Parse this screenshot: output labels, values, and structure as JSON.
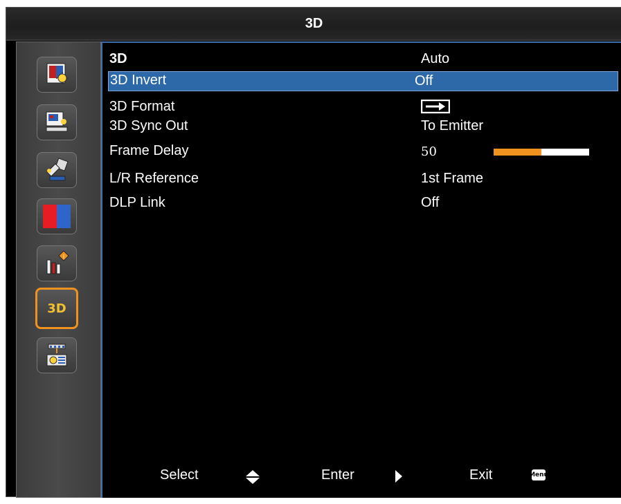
{
  "window": {
    "title": "3D"
  },
  "sidebar": {
    "items": [
      {
        "icon": "image-settings-icon"
      },
      {
        "icon": "display-settings-icon"
      },
      {
        "icon": "setup-icon"
      },
      {
        "icon": "color-icon"
      },
      {
        "icon": "information-icon"
      },
      {
        "icon": "3d-icon",
        "label": "3D",
        "active": true
      },
      {
        "icon": "network-icon"
      }
    ]
  },
  "menu": {
    "rows": [
      {
        "label": "3D",
        "value": "Auto"
      },
      {
        "label": "3D Invert",
        "value": "Off",
        "selected": true
      },
      {
        "label": "3D Format",
        "value_icon": "arrow-right-box-icon"
      },
      {
        "label": "3D Sync Out",
        "value": "To Emitter"
      },
      {
        "label": "Frame Delay",
        "value": "50",
        "slider_percent": 50
      },
      {
        "label": "L/R Reference",
        "value": "1st Frame"
      },
      {
        "label": "DLP Link",
        "value": "Off"
      }
    ]
  },
  "footer": {
    "select_label": "Select",
    "enter_label": "Enter",
    "exit_label": "Exit",
    "menu_badge": "Menu"
  },
  "colors": {
    "accent": "#f0921f",
    "highlight": "#2d68a8",
    "panel_border": "#3e6fa8"
  }
}
